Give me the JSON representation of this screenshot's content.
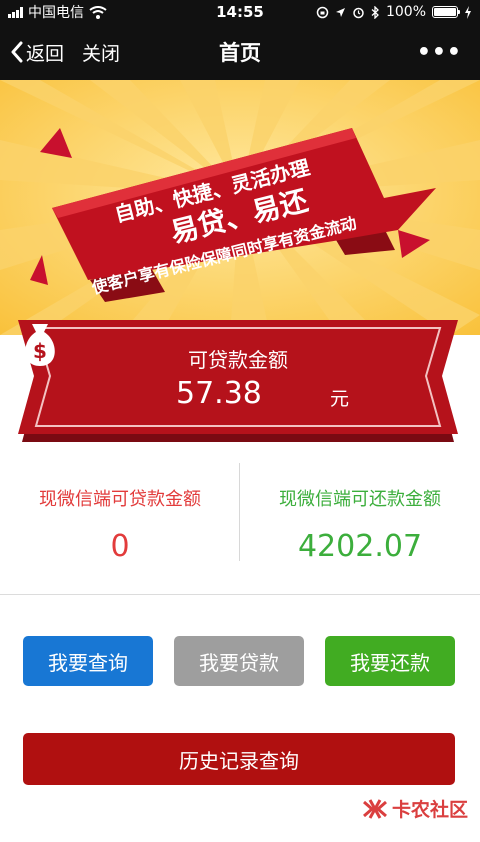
{
  "status_bar": {
    "carrier": "中国电信",
    "time": "14:55",
    "battery": "100%",
    "battery_level": 1.0
  },
  "nav": {
    "back_label": "返回",
    "close_label": "关闭",
    "title": "首页",
    "more_label": "•••"
  },
  "banner": {
    "line1": "自助、快捷、灵活办理",
    "line2": "易贷、易还",
    "line3": "使客户享有保险保障同时享有资金流动"
  },
  "loan_amount": {
    "label": "可贷款金额",
    "value": "57.38",
    "unit": "元"
  },
  "stats": {
    "loan_label": "现微信端可贷款金额",
    "loan_value": "0",
    "repay_label": "现微信端可还款金额",
    "repay_value": "4202.07"
  },
  "buttons": {
    "query": "我要查询",
    "loan": "我要贷款",
    "repay": "我要还款",
    "history": "历史记录查询"
  },
  "watermark": "卡农社区",
  "colors": {
    "brand_red": "#b01010",
    "query_blue": "#1877d4",
    "loan_gray": "#9e9e9e",
    "repay_green": "#41ac22",
    "stat_red": "#e23b3b",
    "stat_green": "#3cae3c"
  }
}
